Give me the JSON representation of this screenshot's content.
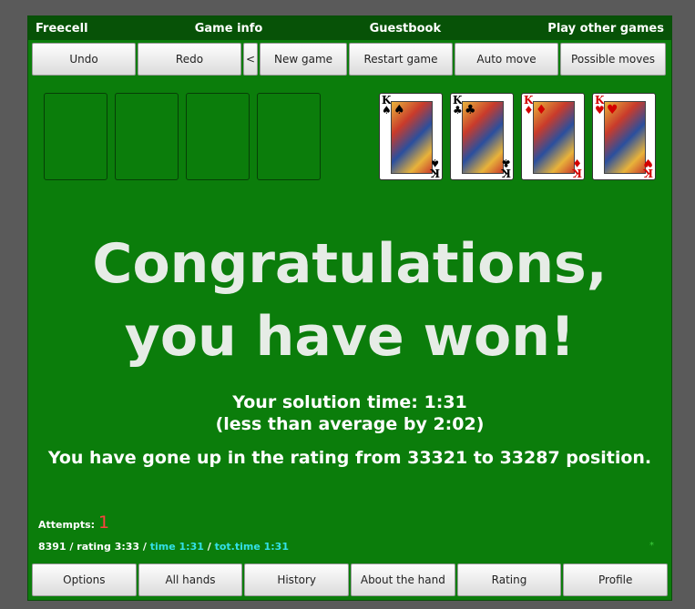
{
  "nav": {
    "freecell": "Freecell",
    "game_info": "Game info",
    "guestbook": "Guestbook",
    "play_other": "Play other games"
  },
  "toolbar": {
    "undo": "Undo",
    "redo": "Redo",
    "back": "<",
    "new_game": "New game",
    "restart": "Restart game",
    "auto_move": "Auto move",
    "possible_moves": "Possible moves"
  },
  "foundations": [
    {
      "rank": "K",
      "suit": "♠",
      "color": "black"
    },
    {
      "rank": "K",
      "suit": "♣",
      "color": "black"
    },
    {
      "rank": "K",
      "suit": "♦",
      "color": "red"
    },
    {
      "rank": "K",
      "suit": "♥",
      "color": "red"
    }
  ],
  "message": {
    "line1": "Congratulations,",
    "line2": "you have won!",
    "solution_time": "Your solution time: 1:31",
    "less_than_avg": "(less than average by 2:02)",
    "rating_change": "You have gone up in the rating from 33321 to 33287 position."
  },
  "attempts": {
    "label": "Attempts:",
    "count": "1"
  },
  "stats": {
    "game_rating": "8391 / rating 3:33 / ",
    "time": "time 1:31",
    "sep": " / ",
    "tot_time": "tot.time 1:31",
    "star": "*"
  },
  "bottombar": {
    "options": "Options",
    "all_hands": "All hands",
    "history": "History",
    "about_hand": "About the hand",
    "rating": "Rating",
    "profile": "Profile"
  },
  "colors": {
    "table_green": "#0b7d0b",
    "nav_green": "#075207",
    "highlight_cyan": "#33e0e8",
    "attempt_red": "#ff4040"
  }
}
